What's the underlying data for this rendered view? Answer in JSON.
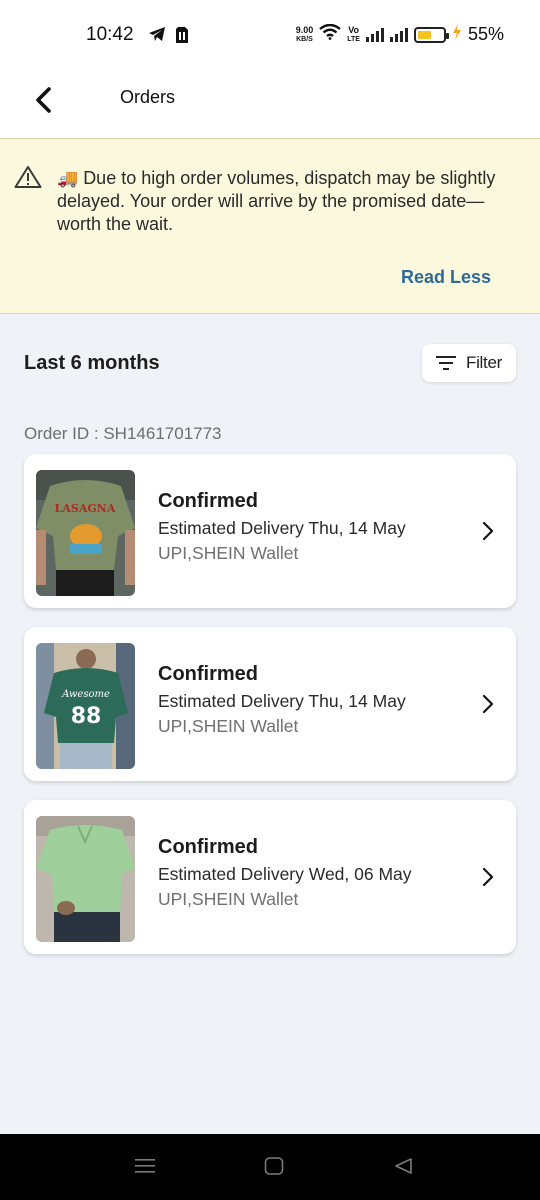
{
  "status_bar": {
    "time": "10:42",
    "speed_value": "9.00",
    "speed_unit": "KB/S",
    "volte_top": "Vo",
    "volte_bottom": "LTE",
    "battery_text": "55%",
    "battery_level": 0.55
  },
  "header": {
    "title": "Orders"
  },
  "notice": {
    "icon": "warning-icon",
    "emoji": "🚚",
    "text": "Due to high order volumes, dispatch may be slightly delayed. Your order will arrive by the promised date—worth the wait.",
    "read_less_label": "Read Less",
    "background": "#fcf8dd"
  },
  "orders_section": {
    "title": "Last 6 months",
    "filter_label": "Filter",
    "order_id": "Order ID : SH1461701773",
    "orders": [
      {
        "status": "Confirmed",
        "delivery": "Estimated Delivery Thu, 14 May",
        "payment": "UPI,SHEIN Wallet",
        "thumb_shirt_color": "#7f8e67",
        "thumb_print_text": "LASAGNA"
      },
      {
        "status": "Confirmed",
        "delivery": "Estimated Delivery Thu, 14 May",
        "payment": "UPI,SHEIN Wallet",
        "thumb_shirt_color": "#2b6b57",
        "thumb_print_text": "Awesome",
        "thumb_number": "88"
      },
      {
        "status": "Confirmed",
        "delivery": "Estimated Delivery Wed, 06 May",
        "payment": "UPI,SHEIN Wallet",
        "thumb_shirt_color": "#9fcf9a"
      }
    ]
  },
  "nav_bar": {
    "items": [
      "menu-icon",
      "home-icon",
      "back-icon"
    ]
  },
  "colors": {
    "accent": "#2f6b99",
    "page_bg": "#eff2f6"
  }
}
